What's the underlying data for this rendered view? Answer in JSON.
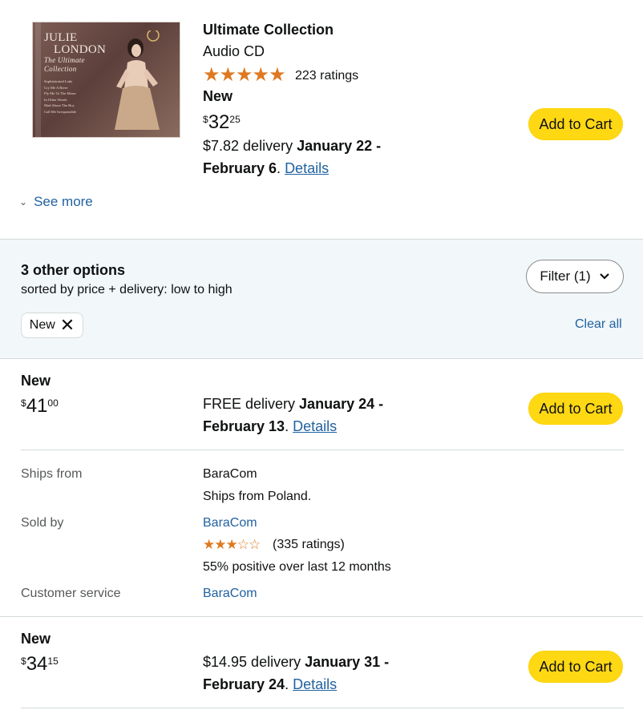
{
  "product": {
    "cover_title_line1": "JULIE",
    "cover_title_line2": "LONDON",
    "cover_title_line3": "The Ultimate Collection",
    "cover_tracks": [
      "Sophisticated Lady",
      "Cry Me A River",
      "Fly Me To The Moon",
      "In Other Words",
      "Mad About The Boy",
      "Call Me Irresponsible"
    ],
    "title": "Ultimate Collection",
    "format": "Audio CD",
    "stars": "★★★★★",
    "rating_count": "223 ratings"
  },
  "main_offer": {
    "condition": "New",
    "price_currency": "$",
    "price_whole": "32",
    "price_fraction": "25",
    "delivery_fee": "$7.82 delivery",
    "delivery_dates": "January 22 - February 6",
    "details_link": "Details",
    "add_to_cart": "Add to Cart"
  },
  "see_more": "See more",
  "options": {
    "title": "3 other options",
    "subtitle": "sorted by price + delivery: low to high",
    "filter_label": "Filter (1)",
    "chip_label": "New",
    "chip_remove": "✕",
    "clear_all": "Clear all"
  },
  "offers": [
    {
      "condition": "New",
      "price_currency": "$",
      "price_whole": "41",
      "price_fraction": "00",
      "delivery_fee": "FREE delivery",
      "delivery_dates": "January 24 - February 13",
      "details_link": "Details",
      "add_to_cart": "Add to Cart",
      "ships_from_label": "Ships from",
      "ships_from_value": "BaraCom",
      "ships_from_note": "Ships from Poland.",
      "sold_by_label": "Sold by",
      "sold_by_value": "BaraCom",
      "seller_stars": "★★★☆☆",
      "seller_ratings": "(335 ratings)",
      "seller_positive": "55% positive over last 12 months",
      "customer_service_label": "Customer service",
      "customer_service_value": "BaraCom"
    },
    {
      "condition": "New",
      "price_currency": "$",
      "price_whole": "34",
      "price_fraction": "15",
      "delivery_fee": "$14.95 delivery",
      "delivery_dates": "January 31 - February 24",
      "details_link": "Details",
      "add_to_cart": "Add to Cart"
    }
  ],
  "colors": {
    "button": "#ffd814",
    "link": "#2162a1",
    "star": "#de7921",
    "banner_bg": "#f2f7fa"
  }
}
